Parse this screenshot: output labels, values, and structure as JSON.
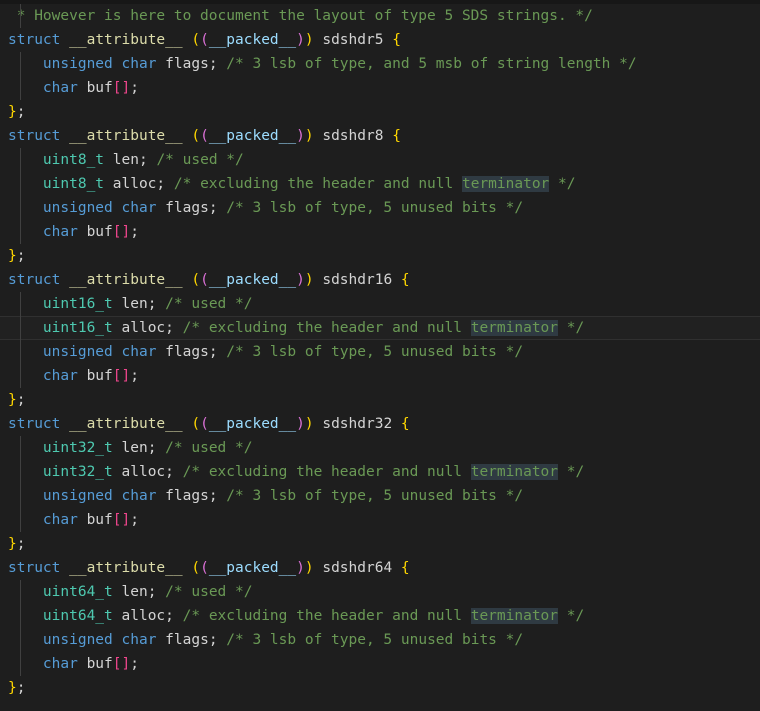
{
  "editor": {
    "app": "code-editor",
    "language": "c",
    "theme": "dark-plus",
    "background": "#1e1e1e",
    "active_line_background": "#212121",
    "word_highlight_background": "#2f3a42",
    "indent_guide_color": "#404040",
    "colors": {
      "keyword": "#569cd6",
      "type": "#4ec9b0",
      "function": "#dcdcaa",
      "identifier": "#d4d4d4",
      "comment": "#6a9955",
      "bracket_level_1": "#ffd700",
      "bracket_level_2": "#da70d6",
      "bracket_square": "#f0468d",
      "parameter": "#9cdcfe"
    },
    "highlighted_word": "terminator",
    "active_line_number": 14,
    "total_lines_visible": 29,
    "lines": [
      " * However is here to document the layout of type 5 SDS strings. */",
      "struct __attribute__ ((__packed__)) sdshdr5 {",
      "    unsigned char flags; /* 3 lsb of type, and 5 msb of string length */",
      "    char buf[];",
      "};",
      "struct __attribute__ ((__packed__)) sdshdr8 {",
      "    uint8_t len; /* used */",
      "    uint8_t alloc; /* excluding the header and null terminator */",
      "    unsigned char flags; /* 3 lsb of type, 5 unused bits */",
      "    char buf[];",
      "};",
      "struct __attribute__ ((__packed__)) sdshdr16 {",
      "    uint16_t len; /* used */",
      "    uint16_t alloc; /* excluding the header and null terminator */",
      "    unsigned char flags; /* 3 lsb of type, 5 unused bits */",
      "    char buf[];",
      "};",
      "struct __attribute__ ((__packed__)) sdshdr32 {",
      "    uint32_t len; /* used */",
      "    uint32_t alloc; /* excluding the header and null terminator */",
      "    unsigned char flags; /* 3 lsb of type, 5 unused bits */",
      "    char buf[];",
      "};",
      "struct __attribute__ ((__packed__)) sdshdr64 {",
      "    uint64_t len; /* used */",
      "    uint64_t alloc; /* excluding the header and null terminator */",
      "    unsigned char flags; /* 3 lsb of type, 5 unused bits */",
      "    char buf[];",
      "};"
    ],
    "tokens": {
      "kw_struct": "struct",
      "kw_unsigned": "unsigned",
      "kw_char": "char",
      "attr_name": "__attribute__",
      "packed": "__packed__",
      "struct_names": [
        "sdshdr5",
        "sdshdr8",
        "sdshdr16",
        "sdshdr32",
        "sdshdr64"
      ],
      "int_types": [
        "uint8_t",
        "uint16_t",
        "uint32_t",
        "uint64_t"
      ],
      "field_len": "len",
      "field_alloc": "alloc",
      "field_flags": "flags",
      "field_buf": "buf",
      "comment_header": " * However is here to document the layout of type 5 SDS strings. */",
      "comment_flags5": "/* 3 lsb of type, and 5 msb of string length */",
      "comment_flags": "/* 3 lsb of type, 5 unused bits */",
      "comment_used": "/* used */",
      "comment_alloc_a": "/* excluding the header and null ",
      "comment_alloc_hl": "terminator",
      "comment_alloc_b": " */",
      "semicolon": ";",
      "brace_open": "{",
      "brace_close": "}",
      "paren_outer_open": "(",
      "paren_inner_open": "(",
      "paren_inner_close": ")",
      "paren_outer_close": ")",
      "bracket_open": "[",
      "bracket_close": "]",
      "indent": "    ",
      "space": " "
    }
  }
}
